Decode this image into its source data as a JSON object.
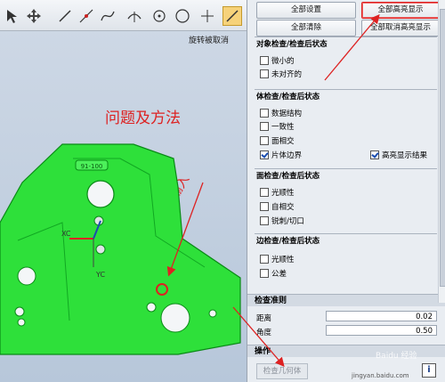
{
  "viewport": {
    "rotate_message": "旋转被取消",
    "annotation_title": "问题及方法",
    "annotation_input": "此输入",
    "part_label": "91-100",
    "axis_xc": "XC",
    "axis_yc": "YC",
    "part_color": "#2ee03a"
  },
  "panel": {
    "top_buttons": {
      "all_settings": "全部设置",
      "all_highlight": "全部高亮显示",
      "all_clear": "全部清除",
      "all_unhighlight": "全部取消高亮显示"
    },
    "groups": [
      {
        "title": "对象检查/检查后状态",
        "items": [
          {
            "label": "微小的",
            "checked": false
          },
          {
            "label": "未对齐的",
            "checked": false
          }
        ]
      },
      {
        "title": "体检查/检查后状态",
        "items": [
          {
            "label": "数据结构",
            "checked": false
          },
          {
            "label": "一致性",
            "checked": false
          },
          {
            "label": "面相交",
            "checked": false
          },
          {
            "label": "片体边界",
            "checked": true
          }
        ],
        "extra": {
          "label": "高亮显示结果",
          "checked": true
        }
      },
      {
        "title": "面检查/检查后状态",
        "items": [
          {
            "label": "光顺性",
            "checked": false
          },
          {
            "label": "自相交",
            "checked": false
          },
          {
            "label": "锐刺/切口",
            "checked": false
          }
        ]
      },
      {
        "title": "边检查/检查后状态",
        "items": [
          {
            "label": "光顺性",
            "checked": false
          },
          {
            "label": "公差",
            "checked": false
          }
        ]
      }
    ],
    "criteria": {
      "header": "检查准则",
      "distance_label": "距离",
      "distance_value": "0.02",
      "angle_label": "角度",
      "angle_value": "0.50"
    },
    "operation": {
      "header": "操作",
      "check_button": "检查几何体",
      "info_icon": "i"
    },
    "watermark": "Baidu 经验",
    "watermark_url": "jingyan.baidu.com"
  }
}
